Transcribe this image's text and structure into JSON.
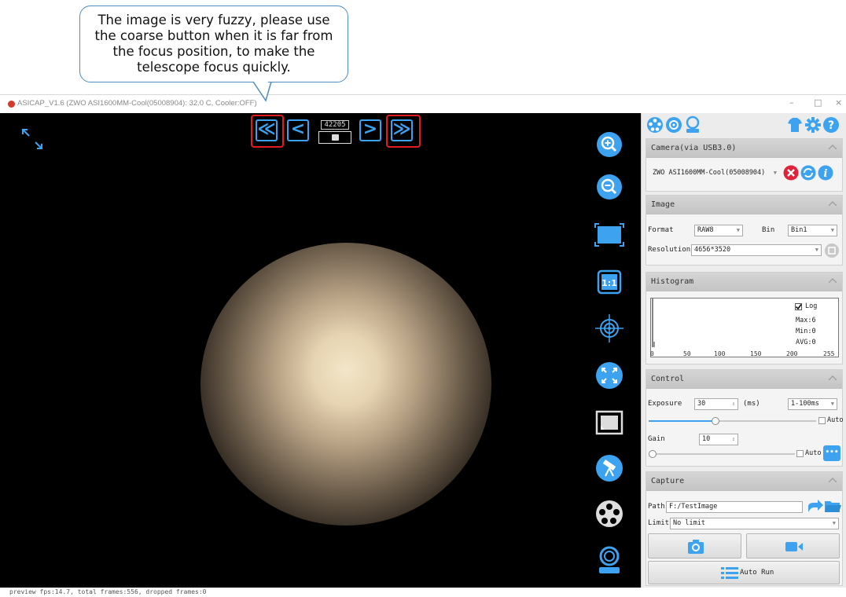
{
  "callout": {
    "text_lines": [
      "The image is very fuzzy, please use",
      "the coarse button when it is far from",
      "the focus position, to make the",
      "telescope focus quickly."
    ]
  },
  "window": {
    "title": "ASICAP_V1.6 (ZWO ASI1600MM-Cool(05008904): 32.0 C, Cooler:OFF)",
    "minimize": "–",
    "maximize": "□",
    "close": "×"
  },
  "focuser": {
    "coarse_left": "≪",
    "fine_left": "<",
    "position": "42205",
    "fine_right": ">",
    "coarse_right": "≫"
  },
  "status": {
    "text": "preview fps:14.7, total frames:556, dropped frames:0"
  },
  "camera": {
    "header": "Camera(via USB3.0)",
    "selected": "ZWO ASI1600MM-Cool(05008904)"
  },
  "image": {
    "header": "Image",
    "format_label": "Format",
    "format_value": "RAW8",
    "bin_label": "Bin",
    "bin_value": "Bin1",
    "resolution_label": "Resolution",
    "resolution_value": "4656*3520"
  },
  "histogram": {
    "header": "Histogram",
    "log_label": "Log",
    "log_checked": true,
    "max": "Max:6",
    "min": "Min:0",
    "avg": "AVG:0",
    "ticks": [
      "0",
      "50",
      "100",
      "150",
      "200",
      "255"
    ]
  },
  "control": {
    "header": "Control",
    "exposure_label": "Exposure",
    "exposure_value": "30",
    "exposure_unit": "(ms)",
    "exposure_range": "1-100ms",
    "exposure_auto": "Auto",
    "exposure_slider_fraction": 0.4,
    "gain_label": "Gain",
    "gain_value": "10",
    "gain_auto": "Auto",
    "gain_slider_fraction": 0.0,
    "more": "•••"
  },
  "capture": {
    "header": "Capture",
    "path_label": "Path",
    "path_value": "F:/TestImage",
    "limit_label": "Limit",
    "limit_value": "No limit",
    "auto_run": "Auto Run"
  },
  "colors": {
    "accent": "#3da3f0",
    "highlight": "#e21c1c",
    "remove": "#e0233a"
  }
}
